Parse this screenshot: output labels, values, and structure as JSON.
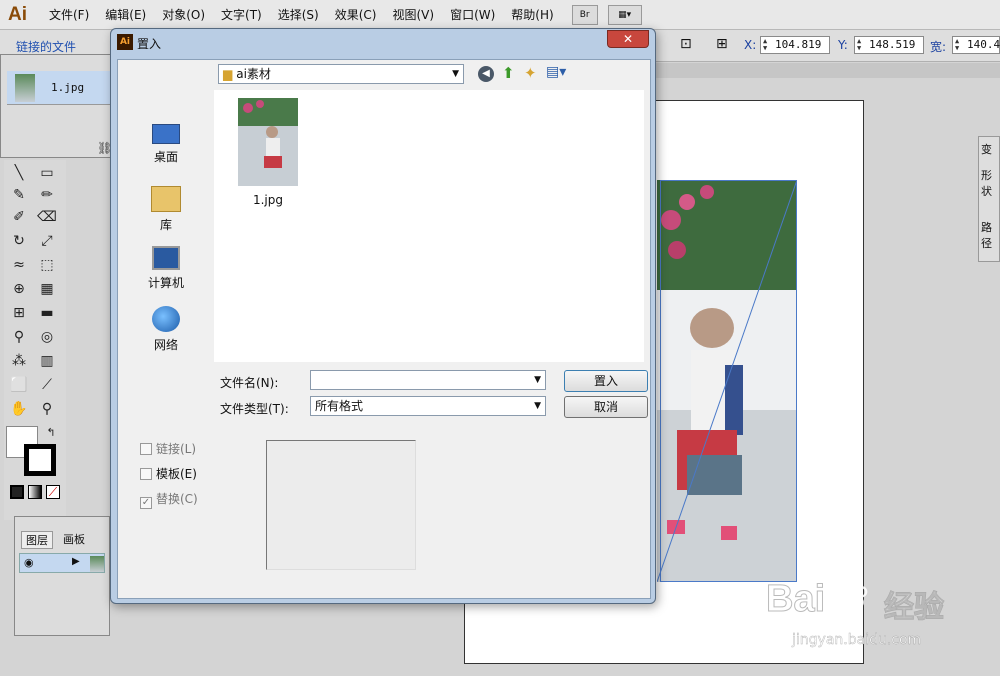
{
  "app": {
    "logo": "Ai"
  },
  "menu": [
    "文件(F)",
    "编辑(E)",
    "对象(O)",
    "文字(T)",
    "选择(S)",
    "效果(C)",
    "视图(V)",
    "窗口(W)",
    "帮助(H)"
  ],
  "menu_buttons": {
    "bridge": "Br",
    "arrange": "▦▾"
  },
  "controlbar": {
    "linked_files": "链接的文件",
    "x_label": "X:",
    "x_value": "104.819",
    "y_label": "Y:",
    "y_value": "148.519",
    "w_label": "宽:",
    "w_value": "140.4"
  },
  "links_panel": {
    "file_name": "1.jpg",
    "warning": "⚠"
  },
  "layers_panel": {
    "tab_layers": "图层",
    "tab_artboards": "画板"
  },
  "right_panel": {
    "a": "变",
    "b": "形状",
    "c": "路径"
  },
  "dialog": {
    "title": "置入",
    "close": "✕",
    "folder": "ai素材",
    "file_item": "1.jpg",
    "places": {
      "desktop": "桌面",
      "library": "库",
      "computer": "计算机",
      "network": "网络"
    },
    "filename_label": "文件名(N):",
    "filename_value": "",
    "filetype_label": "文件类型(T):",
    "filetype_value": "所有格式",
    "place_button": "置入",
    "cancel_button": "取消",
    "check_link": "链接(L)",
    "check_template": "模板(E)",
    "check_replace": "替换(C)",
    "check_replace_mark": "✓"
  },
  "watermark": {
    "brand": "Bai",
    "brand2": "经验",
    "url": "jingyan.baidu.com"
  }
}
